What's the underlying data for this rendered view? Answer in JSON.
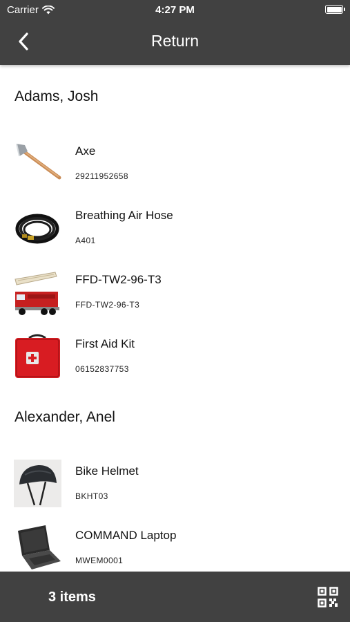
{
  "status_bar": {
    "carrier": "Carrier",
    "time": "4:27 PM"
  },
  "nav": {
    "title": "Return",
    "back_icon": "chevron-left-icon"
  },
  "groups": [
    {
      "name": "Adams, Josh",
      "items": [
        {
          "name": "Axe",
          "code": "29211952658",
          "image": "axe"
        },
        {
          "name": "Breathing Air Hose",
          "code": "A401",
          "image": "hose"
        },
        {
          "name": "FFD-TW2-96-T3",
          "code": "FFD-TW2-96-T3",
          "image": "fire-truck"
        },
        {
          "name": "First Aid Kit",
          "code": "06152837753",
          "image": "first-aid-kit"
        }
      ]
    },
    {
      "name": "Alexander, Anel",
      "items": [
        {
          "name": "Bike Helmet",
          "code": "BKHT03",
          "image": "bike-helmet"
        },
        {
          "name": "COMMAND Laptop",
          "code": "MWEM0001",
          "image": "laptop"
        }
      ]
    }
  ],
  "footer": {
    "count_label": "3 items",
    "qr_icon": "qr-code-icon"
  },
  "colors": {
    "bar": "#414141",
    "background": "#ffffff",
    "text": "#111111"
  }
}
